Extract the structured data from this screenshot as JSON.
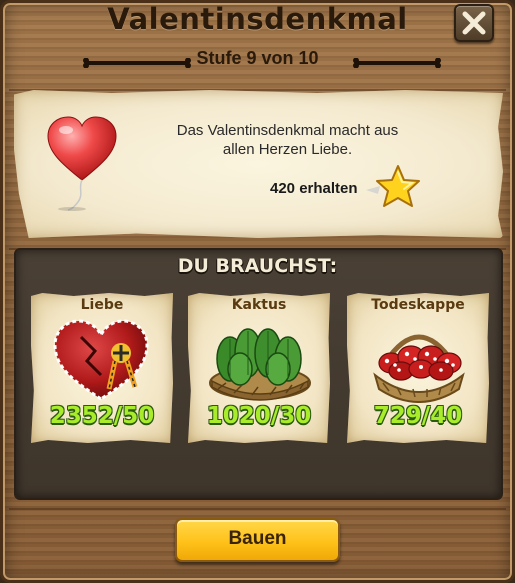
{
  "dialog": {
    "title": "Valentinsdenkmal",
    "level_text": "Stufe 9 von 10"
  },
  "info": {
    "description": "Das Valentinsdenkmal macht aus allen Herzen Liebe.",
    "reward_text": "420 erhalten",
    "reward_icon": "star-icon",
    "item_icon": "heart-balloon-icon"
  },
  "requirements": {
    "heading": "DU BRAUCHST:",
    "items": [
      {
        "name": "Liebe",
        "count": "2352/50",
        "icon": "heart-icon"
      },
      {
        "name": "Kaktus",
        "count": "1020/30",
        "icon": "cactus-basket-icon"
      },
      {
        "name": "Todeskappe",
        "count": "729/40",
        "icon": "mushroom-basket-icon"
      }
    ]
  },
  "actions": {
    "build_label": "Bauen"
  },
  "colors": {
    "count_green": "#a8ec2c",
    "button_yellow": "#ffc21a",
    "wood": "#94693f"
  }
}
